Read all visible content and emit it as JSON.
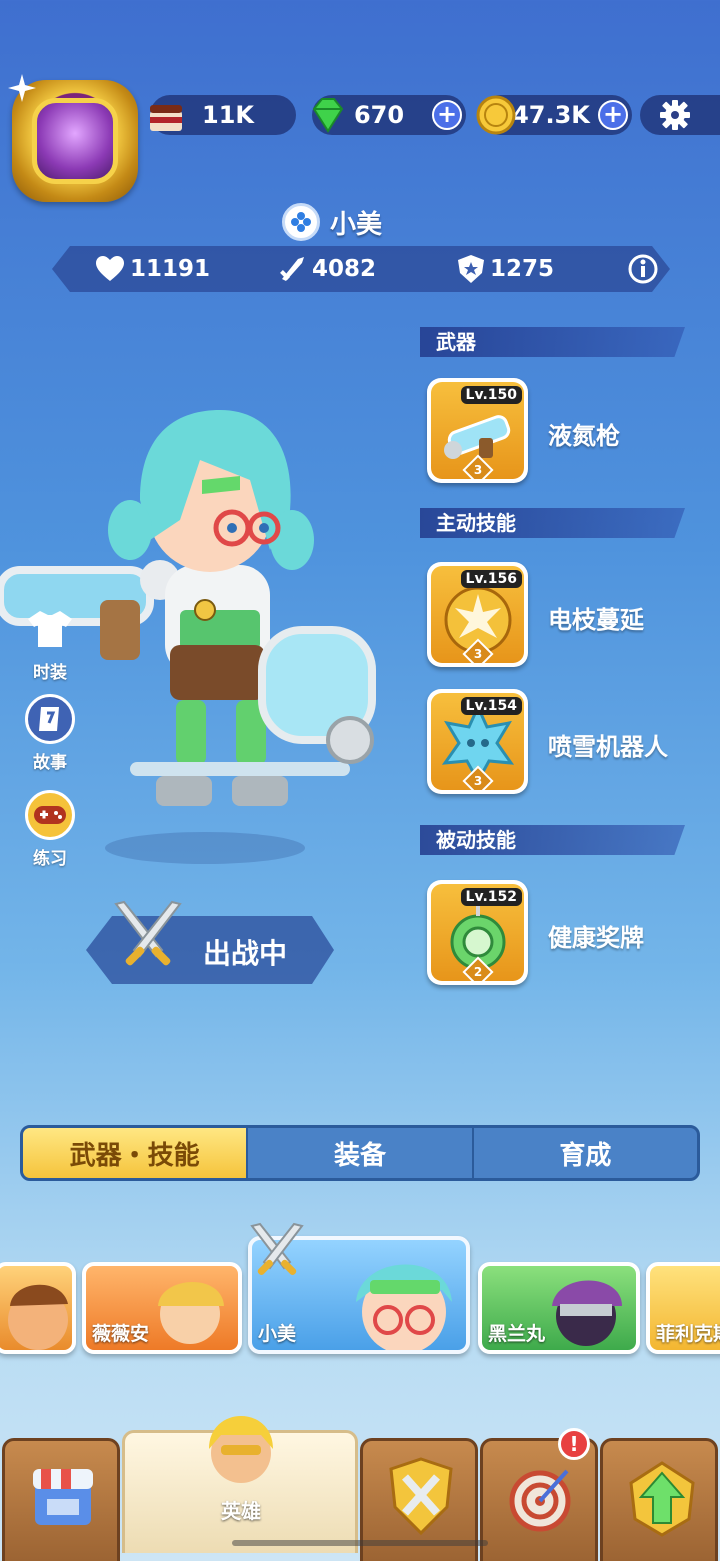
{
  "currencies": {
    "cake": {
      "value": "11K",
      "icon": "cake-icon"
    },
    "gems": {
      "value": "670",
      "icon": "gem-icon"
    },
    "coins": {
      "value": "47.3K",
      "icon": "coin-icon"
    },
    "plus_label": "+"
  },
  "hero": {
    "name": "小美",
    "stats": {
      "hp": "11191",
      "attack": "4082",
      "defense": "1275"
    }
  },
  "sections": {
    "weapon": {
      "title": "武器",
      "items": [
        {
          "name": "液氮枪",
          "level": "Lv.150",
          "stars": "3"
        }
      ]
    },
    "active": {
      "title": "主动技能",
      "items": [
        {
          "name": "电枝蔓延",
          "level": "Lv.156",
          "stars": "3"
        },
        {
          "name": "喷雪机器人",
          "level": "Lv.154",
          "stars": "3"
        }
      ]
    },
    "passive": {
      "title": "被动技能",
      "items": [
        {
          "name": "健康奖牌",
          "level": "Lv.152",
          "stars": "2"
        }
      ]
    }
  },
  "side_buttons": [
    {
      "label": "时装",
      "icon": "shirt-icon"
    },
    {
      "label": "故事",
      "icon": "book-icon"
    },
    {
      "label": "练习",
      "icon": "gamepad-icon"
    }
  ],
  "battle_status": "出战中",
  "tabs": [
    {
      "label": "武器・技能",
      "active": true
    },
    {
      "label": "装备",
      "active": false
    },
    {
      "label": "育成",
      "active": false
    }
  ],
  "roster": [
    {
      "name": "",
      "color": "#5fb0e8"
    },
    {
      "name": "薇薇安",
      "color": "#f0822e"
    },
    {
      "name": "小美",
      "color": "#4aa0e8",
      "selected": true
    },
    {
      "name": "黑兰丸",
      "color": "#4cb85a"
    },
    {
      "name": "菲利克斯",
      "color": "#f5c53a"
    }
  ],
  "nav": [
    {
      "label": "",
      "icon": "shop-icon"
    },
    {
      "label": "英雄",
      "icon": "hero-icon",
      "active": true
    },
    {
      "label": "",
      "icon": "battle-shield-icon"
    },
    {
      "label": "",
      "icon": "target-icon",
      "alert": "!"
    },
    {
      "label": "",
      "icon": "upgrade-arrow-icon"
    }
  ],
  "colors": {
    "accent_gold": "#f5c43c",
    "tab_blue": "#4a82c7",
    "alert_red": "#e84040"
  }
}
